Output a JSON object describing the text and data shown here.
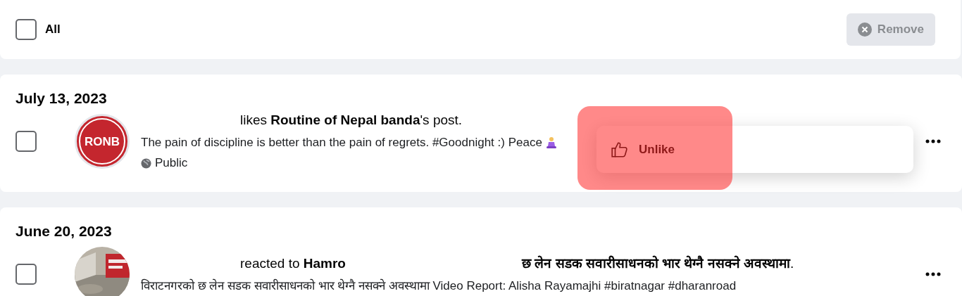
{
  "toolbar": {
    "select_all": {
      "label": "All",
      "checked": false
    },
    "remove_button": {
      "label": "Remove",
      "disabled": true
    }
  },
  "groups": [
    {
      "date": "July 13, 2023",
      "items": [
        {
          "checked": false,
          "avatar": {
            "kind": "logo",
            "text": "RONB"
          },
          "action": "likes",
          "target": "Routine of Nepal banda",
          "suffix": "'s post",
          "end": ".",
          "body": "The pain of discipline is better than the pain of regrets. #Goodnight :) Peace",
          "privacy": "Public",
          "menu": {
            "items": [
              {
                "label": "Unlike",
                "highlighted": true
              }
            ]
          }
        }
      ]
    },
    {
      "date": "June 20, 2023",
      "items": [
        {
          "checked": false,
          "action": "reacted to",
          "target": "Hamro",
          "trailing_bold": "छ लेन सडक सवारीसाधनको भार थेग्नै नसक्ने अवस्थामा",
          "end": ".",
          "body": "विराटनगरको छ लेन सडक सवारीसाधनको भार थेग्नै नसक्ने अवस्थामा Video Report: Alisha Rayamajhi #biratnagar #dharanroad"
        }
      ]
    }
  ]
}
